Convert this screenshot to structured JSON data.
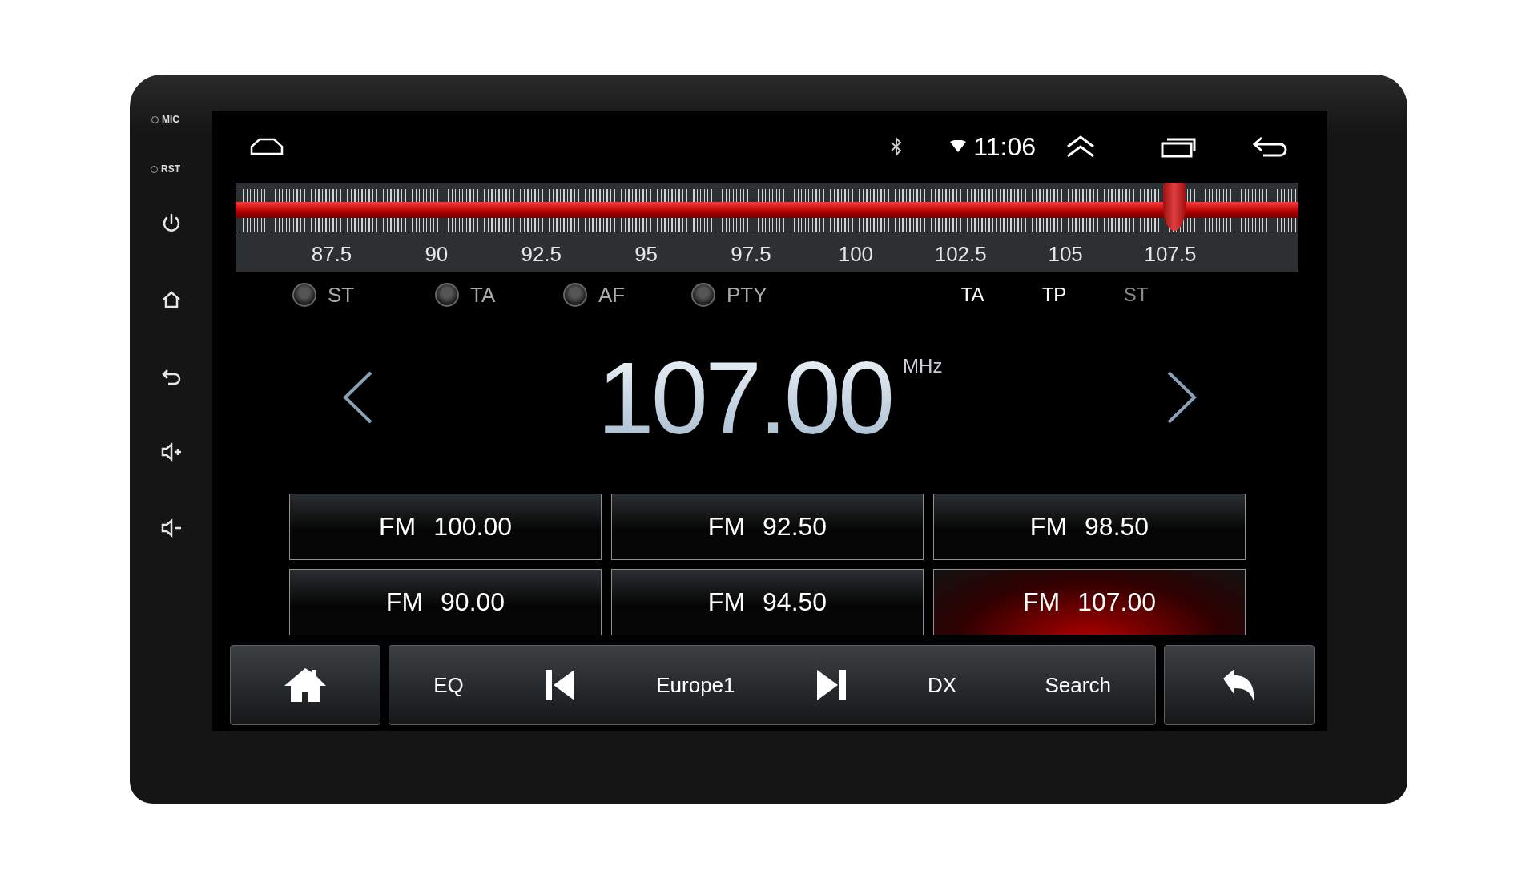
{
  "side_panel": {
    "labels": [
      "MIC",
      "RST"
    ]
  },
  "status_bar": {
    "time": "11:06"
  },
  "tuner": {
    "level": 0.883,
    "scale": [
      "87.5",
      "90",
      "92.5",
      "95",
      "97.5",
      "100",
      "102.5",
      "105",
      "107.5"
    ]
  },
  "options": [
    {
      "label": "ST",
      "checked": false
    },
    {
      "label": "TA",
      "checked": false
    },
    {
      "label": "AF",
      "checked": false
    },
    {
      "label": "PTY",
      "checked": false
    }
  ],
  "indicators": [
    {
      "label": "TA",
      "on": true
    },
    {
      "label": "TP",
      "on": true
    },
    {
      "label": "ST",
      "on": false
    }
  ],
  "frequency": {
    "value": "107.00",
    "unit": "MHz"
  },
  "presets": [
    {
      "band": "FM",
      "freq": "100.00",
      "selected": false
    },
    {
      "band": "FM",
      "freq": "92.50",
      "selected": false
    },
    {
      "band": "FM",
      "freq": "98.50",
      "selected": false
    },
    {
      "band": "FM",
      "freq": "90.00",
      "selected": false
    },
    {
      "band": "FM",
      "freq": "94.50",
      "selected": false
    },
    {
      "band": "FM",
      "freq": "107.00",
      "selected": true
    }
  ],
  "controls": [
    {
      "kind": "text",
      "label": "EQ"
    },
    {
      "kind": "prev"
    },
    {
      "kind": "text",
      "label": "Europe1"
    },
    {
      "kind": "next"
    },
    {
      "kind": "text",
      "label": "DX"
    },
    {
      "kind": "text",
      "label": "Search"
    }
  ]
}
